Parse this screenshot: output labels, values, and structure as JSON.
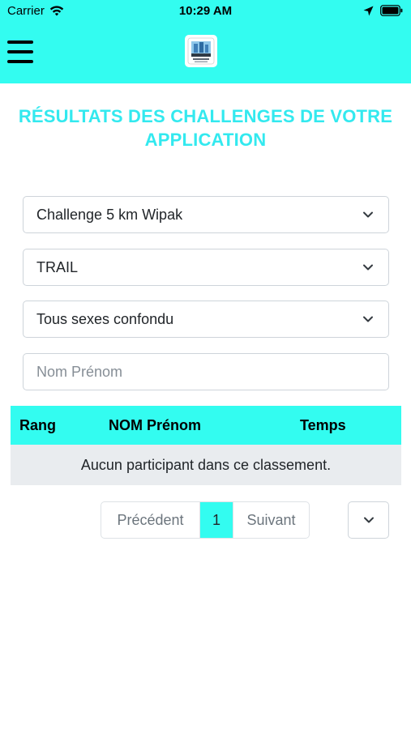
{
  "status_bar": {
    "carrier": "Carrier",
    "time": "10:29 AM",
    "icons": [
      "wifi-icon",
      "location-arrow-icon",
      "battery-icon"
    ]
  },
  "header": {
    "background_color": "#33fcf0",
    "menu_icon": "hamburger-menu-icon",
    "logo": "app-logo"
  },
  "page_title": {
    "line1": "RÉSULTATS DES CHALLENGES DE VOTRE",
    "line2": "APPLICATION",
    "color": "#33e9ef"
  },
  "filters": {
    "challenge": "Challenge 5 km Wipak",
    "category": "TRAIL",
    "sex": "Tous sexes confondu",
    "name_search_placeholder": "Nom Prénom"
  },
  "results_table": {
    "columns": [
      "Rang",
      "NOM Prénom",
      "Temps"
    ],
    "empty_message": "Aucun participant dans ce classement.",
    "header_color": "#33fcf0"
  },
  "pagination": {
    "previous_label": "Précédent",
    "current_page": "1",
    "next_label": "Suivant"
  }
}
